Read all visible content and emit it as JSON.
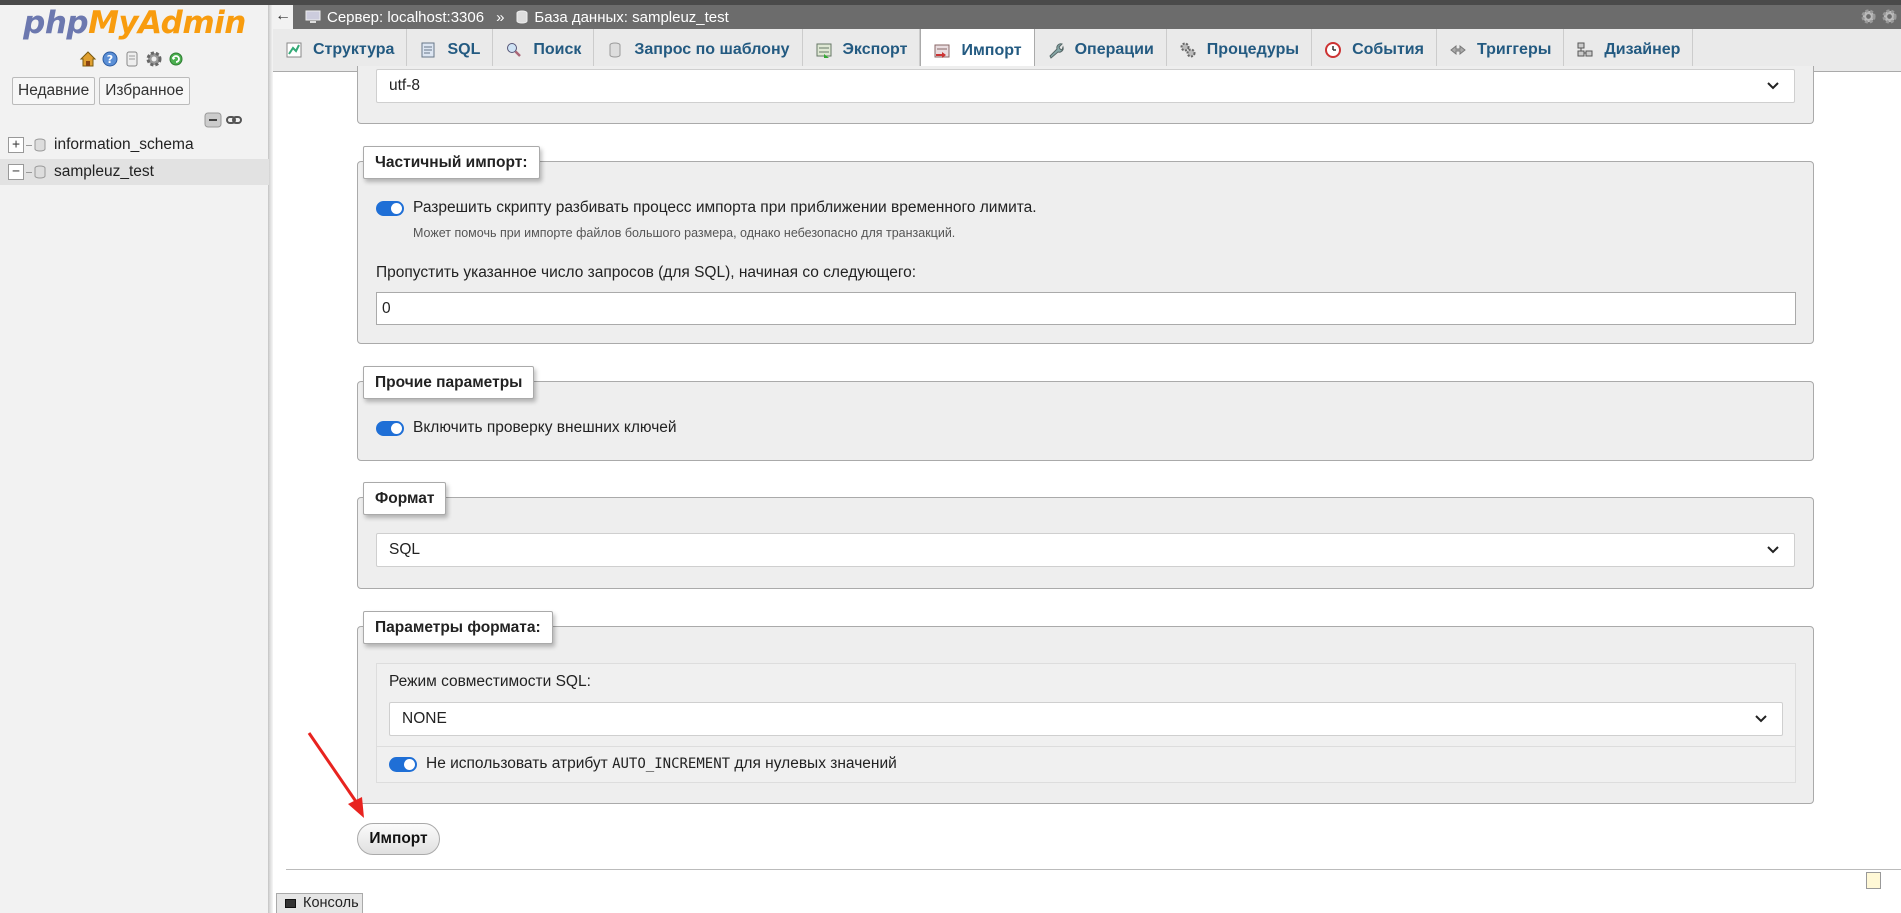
{
  "app": {
    "logo_php": "php",
    "logo_myadmin": "MyAdmin"
  },
  "nav": {
    "tabs": [
      "Недавние",
      "Избранное"
    ],
    "databases": [
      "information_schema",
      "sampleuz_test"
    ]
  },
  "breadcrumb": {
    "server": "Сервер: localhost:3306",
    "separator": "»",
    "database": "База данных: sampleuz_test"
  },
  "tabs": [
    {
      "label": "Структура",
      "icon": "structure-icon"
    },
    {
      "label": "SQL",
      "icon": "sql-icon"
    },
    {
      "label": "Поиск",
      "icon": "search-icon"
    },
    {
      "label": "Запрос по шаблону",
      "icon": "query-icon"
    },
    {
      "label": "Экспорт",
      "icon": "export-icon"
    },
    {
      "label": "Импорт",
      "icon": "import-icon",
      "active": true
    },
    {
      "label": "Операции",
      "icon": "wrench-icon"
    },
    {
      "label": "Процедуры",
      "icon": "routines-icon"
    },
    {
      "label": "События",
      "icon": "events-icon"
    },
    {
      "label": "Триггеры",
      "icon": "triggers-icon"
    },
    {
      "label": "Дизайнер",
      "icon": "designer-icon"
    }
  ],
  "charset": {
    "value": "utf-8"
  },
  "partial_import": {
    "legend": "Частичный импорт:",
    "allow_interrupt_label": "Разрешить скрипту разбивать процесс импорта при приближении временного лимита.",
    "allow_interrupt_hint": "Может помочь при импорте файлов большого размера, однако небезопасно для транзакций.",
    "allow_interrupt_on": true,
    "skip_label": "Пропустить указанное число запросов (для SQL), начиная со следующего:",
    "skip_value": "0"
  },
  "other_options": {
    "legend": "Прочие параметры",
    "fk_label": "Включить проверку внешних ключей",
    "fk_on": true
  },
  "format": {
    "legend": "Формат",
    "value": "SQL"
  },
  "format_options": {
    "legend": "Параметры формата:",
    "compat_label": "Режим совместимости SQL:",
    "compat_value": "NONE",
    "no_auto_value_pre": "Не использовать атрибут",
    "no_auto_value_code": "AUTO_INCREMENT",
    "no_auto_value_post": "для нулевых значений",
    "no_auto_value_on": true
  },
  "submit": {
    "label": "Импорт"
  },
  "console": {
    "label": "Консоль"
  },
  "colors": {
    "tab_text": "#235a81",
    "toggle": "#1f6fd6",
    "arrow": "#e8231f"
  }
}
